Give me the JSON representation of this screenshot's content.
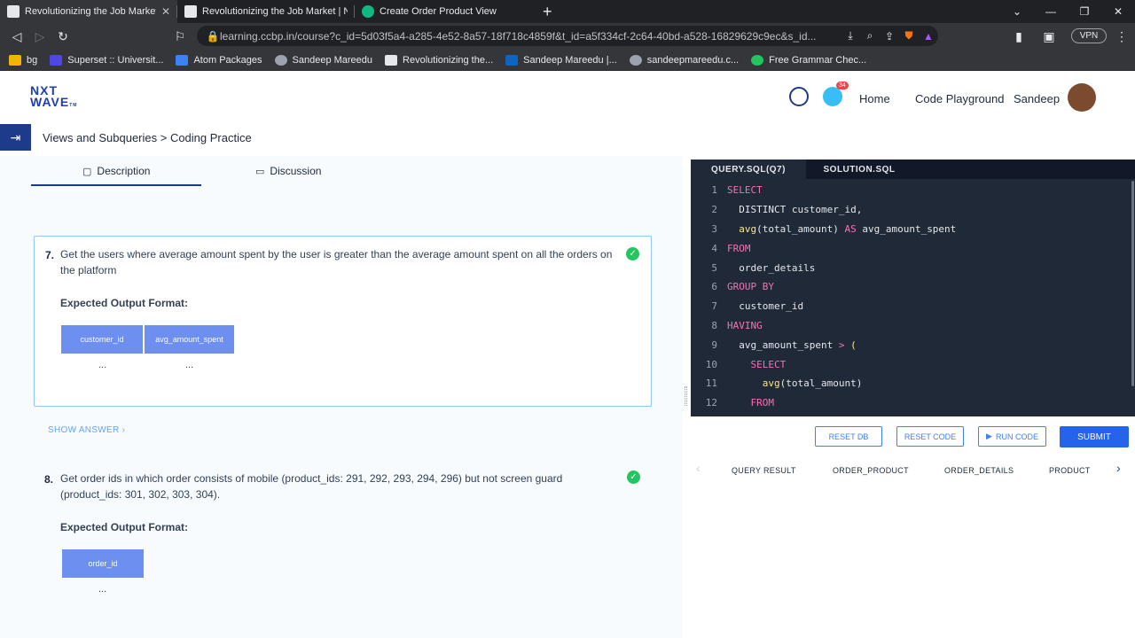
{
  "browser": {
    "tabs": [
      {
        "title": "Revolutionizing the Job Market | N",
        "active": true
      },
      {
        "title": "Revolutionizing the Job Market | NxtW",
        "active": false
      },
      {
        "title": "Create Order Product View",
        "active": false
      }
    ],
    "url": "learning.ccbp.in/course?c_id=5d03f5a4-a285-4e52-8a57-18f718c4859f&t_id=a5f334cf-2c64-40bd-a528-16829629c9ec&s_id...",
    "vpn_label": "VPN",
    "bookmarks": [
      "bg",
      "Superset :: Universit...",
      "Atom Packages",
      "Sandeep Mareedu",
      "Revolutionizing the...",
      "Sandeep Mareedu |...",
      "sandeepmareedu.c...",
      "Free Grammar Chec..."
    ]
  },
  "header": {
    "logo_top": "NXT",
    "logo_bottom": "WAVE",
    "logo_tm": "TM",
    "notification_count": "34",
    "nav": {
      "home": "Home",
      "playground": "Code Playground",
      "user": "Sandeep"
    }
  },
  "breadcrumb": "Views and Subqueries > Coding Practice",
  "panel_tabs": {
    "description": "Description",
    "discussion": "Discussion"
  },
  "questions": [
    {
      "number": "7.",
      "text": "Get the  users where average amount spent by the user is greater than the average amount spent on all the orders on the platform",
      "expected_label": "Expected Output Format:",
      "columns": [
        "customer_id",
        "avg_amount_spent"
      ],
      "placeholder": "..."
    },
    {
      "number": "8.",
      "text": "Get order ids in which order consists of mobile (product_ids: 291, 292, 293, 294, 296) but not screen guard (product_ids: 301, 302, 303, 304).",
      "expected_label": "Expected Output Format:",
      "columns": [
        "order_id"
      ],
      "placeholder": "..."
    }
  ],
  "show_answer": "SHOW ANSWER",
  "editor": {
    "tabs": [
      "QUERY.SQL(Q7)",
      "SOLUTION.SQL"
    ],
    "lines": [
      {
        "n": "1",
        "parts": [
          [
            "kw",
            "SELECT"
          ]
        ]
      },
      {
        "n": "2",
        "parts": [
          [
            "txt",
            "  DISTINCT customer_id,"
          ]
        ]
      },
      {
        "n": "3",
        "parts": [
          [
            "fn",
            "  avg"
          ],
          [
            "txt",
            "(total_amount) "
          ],
          [
            "kw",
            "AS"
          ],
          [
            "txt",
            " avg_amount_spent"
          ]
        ]
      },
      {
        "n": "4",
        "parts": [
          [
            "kw",
            "FROM"
          ]
        ]
      },
      {
        "n": "5",
        "parts": [
          [
            "txt",
            "  order_details"
          ]
        ]
      },
      {
        "n": "6",
        "parts": [
          [
            "kw",
            "GROUP BY"
          ]
        ]
      },
      {
        "n": "7",
        "parts": [
          [
            "txt",
            "  customer_id"
          ]
        ]
      },
      {
        "n": "8",
        "parts": [
          [
            "kw",
            "HAVING"
          ]
        ]
      },
      {
        "n": "9",
        "parts": [
          [
            "txt",
            "  avg_amount_spent "
          ],
          [
            "kw",
            ">"
          ],
          [
            "fn",
            " ("
          ]
        ]
      },
      {
        "n": "10",
        "parts": [
          [
            "kw",
            "    SELECT"
          ]
        ]
      },
      {
        "n": "11",
        "parts": [
          [
            "fn",
            "      avg"
          ],
          [
            "txt",
            "(total_amount)"
          ]
        ]
      },
      {
        "n": "12",
        "parts": [
          [
            "kw",
            "    FROM"
          ]
        ]
      }
    ]
  },
  "actions": {
    "reset_db": "RESET DB",
    "reset_code": "RESET CODE",
    "run_code": "RUN CODE",
    "submit": "SUBMIT"
  },
  "result_tabs": [
    "QUERY RESULT",
    "ORDER_PRODUCT",
    "ORDER_DETAILS",
    "PRODUCT"
  ],
  "colors": {
    "accent": "#2563eb",
    "header_cell": "#6d8ff0",
    "editor_bg": "#1f2937",
    "keyword": "#f472b6",
    "success": "#22c55e"
  }
}
